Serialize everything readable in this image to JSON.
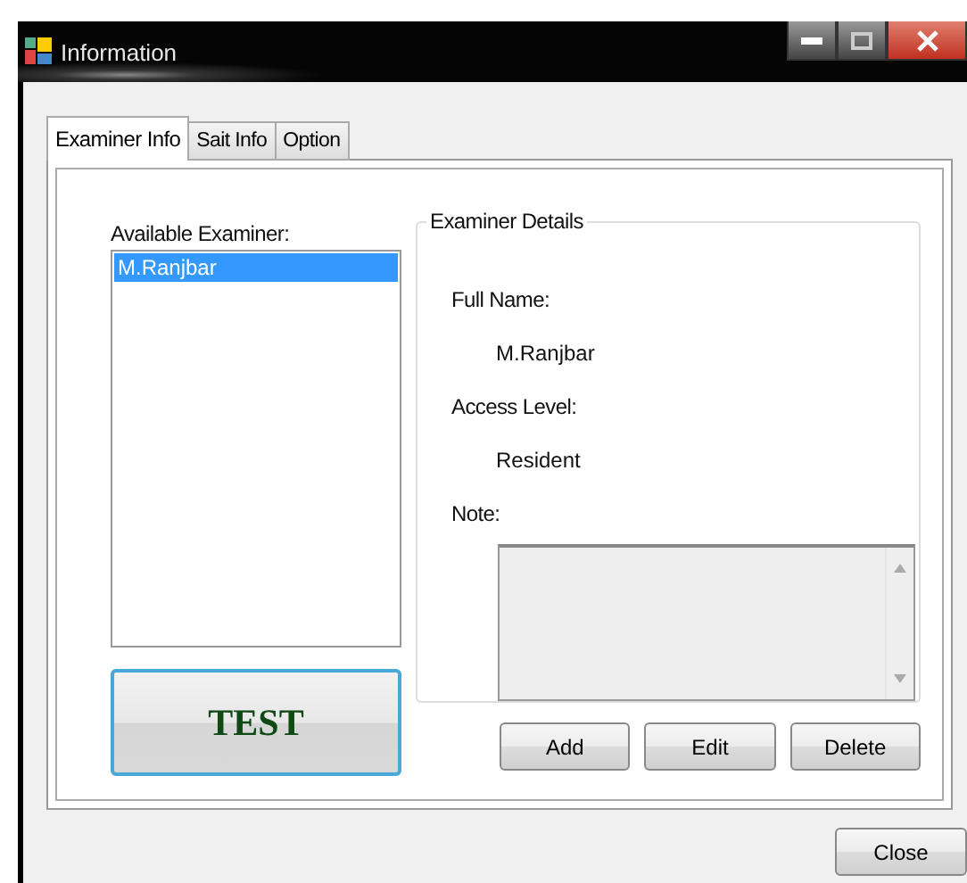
{
  "window": {
    "title": "Information"
  },
  "tabs": [
    {
      "label": "Examiner Info",
      "selected": true
    },
    {
      "label": "Sait Info",
      "selected": false
    },
    {
      "label": "Option",
      "selected": false
    }
  ],
  "examiner_list": {
    "label": "Available Examiner:",
    "items": [
      {
        "name": "M.Ranjbar",
        "selected": true
      }
    ]
  },
  "test_button": "TEST",
  "details": {
    "title": "Examiner Details",
    "fields": [
      {
        "label": "Full Name:",
        "value": "M.Ranjbar"
      },
      {
        "label": "Access Level:",
        "value": "Resident"
      }
    ],
    "note_label": "Note:"
  },
  "buttons": [
    "Add",
    "Edit",
    "Delete"
  ],
  "close_button": "Close"
}
